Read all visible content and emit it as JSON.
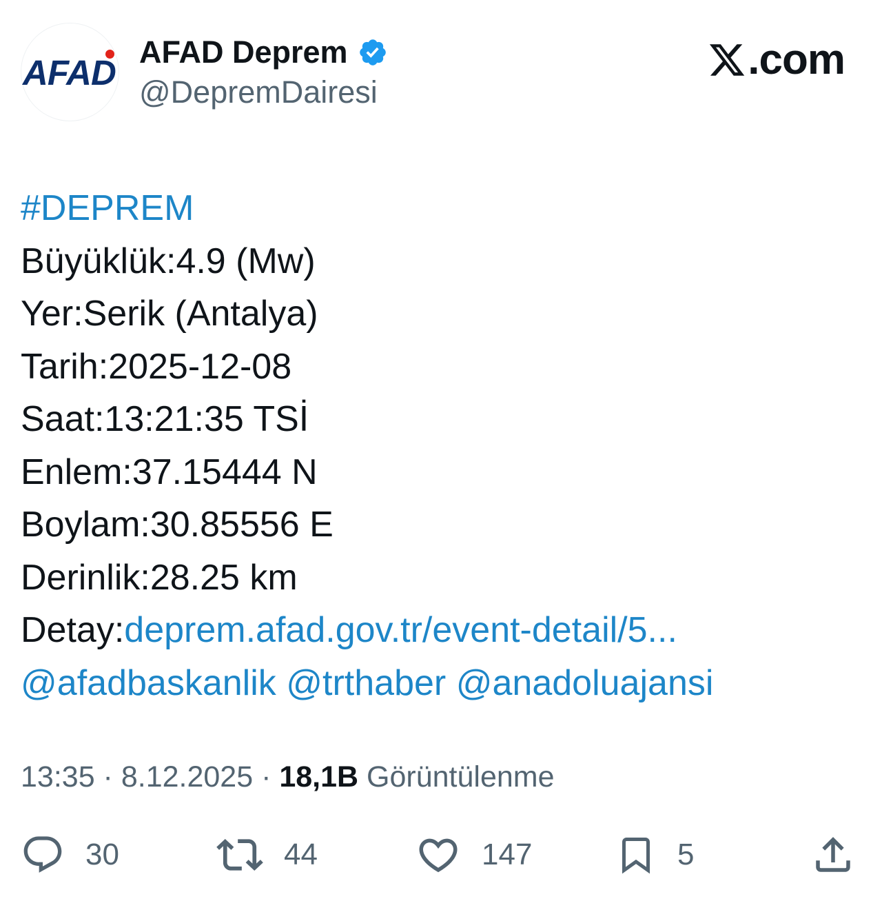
{
  "author": {
    "avatar_text": "AFAD",
    "display_name": "AFAD Deprem",
    "handle": "@DepremDairesi",
    "verified": true
  },
  "brand": {
    "text": ".com"
  },
  "post": {
    "hashtag": "#DEPREM",
    "lines": [
      "Büyüklük:4.9 (Mw)",
      "Yer:Serik (Antalya)",
      "Tarih:2025-12-08",
      "Saat:13:21:35 TSİ",
      "Enlem:37.15444 N",
      "Boylam:30.85556 E",
      "Derinlik:28.25 km"
    ],
    "detail_label": "Detay:",
    "detail_link": "deprem.afad.gov.tr/event-detail/5...",
    "mentions": [
      "@afadbaskanlik",
      "@trthaber",
      "@anadoluajansi"
    ]
  },
  "meta": {
    "time": "13:35",
    "separator": " · ",
    "date": "8.12.2025",
    "views_count": "18,1B",
    "views_label": "Görüntülenme"
  },
  "actions": {
    "reply_count": "30",
    "repost_count": "44",
    "like_count": "147",
    "bookmark_count": "5"
  },
  "colors": {
    "link": "#1d86c8",
    "verified": "#1d9bf0",
    "text": "#0f1419",
    "muted": "#536471",
    "logo_blue": "#0d2f6c",
    "logo_red": "#e2231a"
  }
}
